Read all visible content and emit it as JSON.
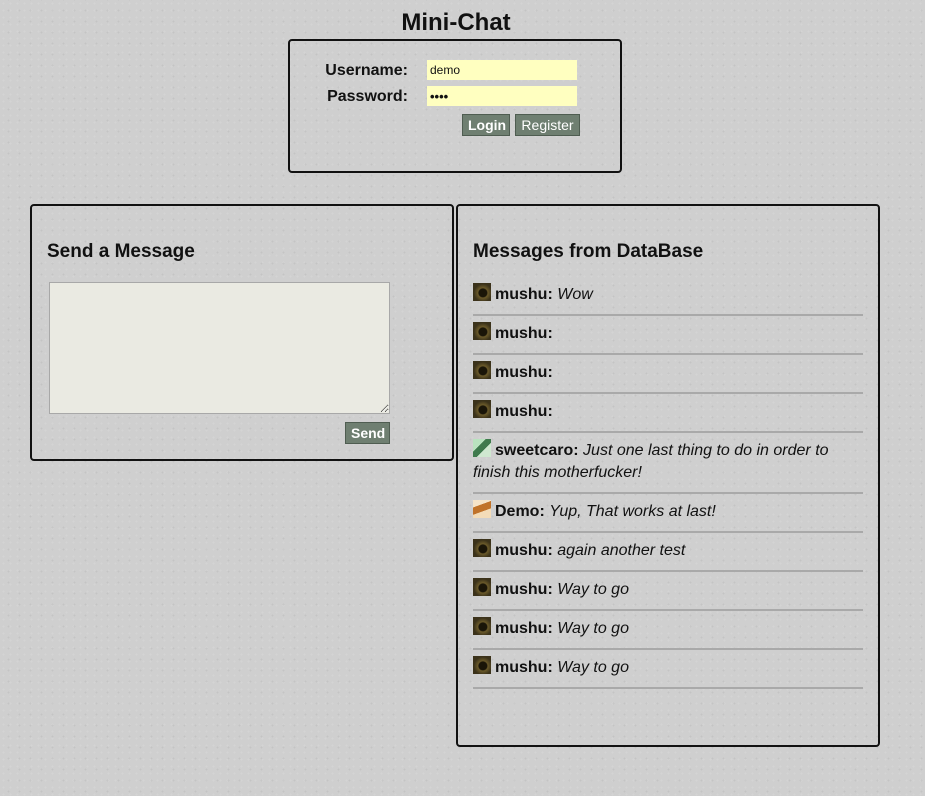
{
  "app": {
    "title": "Mini-Chat"
  },
  "login": {
    "username_label": "Username:",
    "username_value": "demo",
    "password_label": "Password:",
    "password_value": "demo",
    "login_button": "Login",
    "register_button": "Register"
  },
  "send_panel": {
    "title": "Send a Message",
    "message_value": "",
    "send_button": "Send"
  },
  "messages_panel": {
    "title": "Messages from DataBase",
    "messages": [
      {
        "avatar": "dark-eye-avatar",
        "user": "mushu:",
        "text": "Wow"
      },
      {
        "avatar": "dark-eye-avatar",
        "user": "mushu:",
        "text": ""
      },
      {
        "avatar": "dark-eye-avatar",
        "user": "mushu:",
        "text": ""
      },
      {
        "avatar": "dark-eye-avatar",
        "user": "mushu:",
        "text": ""
      },
      {
        "avatar": "green-portrait-avatar",
        "user": "sweetcaro:",
        "text": "Just one last thing to do in order to finish this motherfucker!"
      },
      {
        "avatar": "tan-portrait-avatar",
        "user": "Demo:",
        "text": "Yup, That works at last!"
      },
      {
        "avatar": "dark-eye-avatar",
        "user": "mushu:",
        "text": "again another test"
      },
      {
        "avatar": "dark-eye-avatar",
        "user": "mushu:",
        "text": "Way to go"
      },
      {
        "avatar": "dark-eye-avatar",
        "user": "mushu:",
        "text": "Way to go"
      },
      {
        "avatar": "dark-eye-avatar",
        "user": "mushu:",
        "text": "Way to go"
      }
    ]
  },
  "colors": {
    "input_background": "#ffffc0",
    "button_background": "#6f7f71",
    "page_background": "#cfcfcf"
  }
}
